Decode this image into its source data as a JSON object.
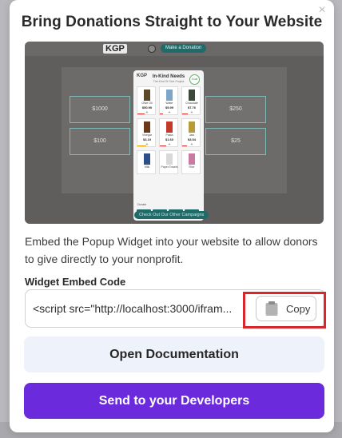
{
  "modal": {
    "title": "Bring Donations Straight to Your Website",
    "close_icon": "close-icon",
    "description": "Embed the Popup Widget into your website to allow donors to give directly to your nonprofit.",
    "embed_label": "Widget Embed Code",
    "embed_code_value": "<script src=\"http://localhost:3000/ifram...",
    "copy_label": "Copy",
    "copy_icon": "clipboard-icon",
    "doc_button_label": "Open Documentation",
    "dev_button_label": "Send to your Developers",
    "accent_color": "#6b2bdd",
    "highlight_color": "#d8262c"
  },
  "preview": {
    "logo": "KGP",
    "nav_pill": "Make a Donation",
    "bottom_pill": "Check Out Our Other Campaigns",
    "donation_amounts": [
      "$1000",
      "$250",
      "$100",
      "$25"
    ],
    "widget": {
      "title": "In-Kind Needs",
      "subtitle": "The Kind Of Give Project",
      "badge": "Goal",
      "donate_label": "Donate",
      "items": [
        {
          "name": "Olive Oil",
          "price": "$50.90"
        },
        {
          "name": "Water",
          "price": "$5.99"
        },
        {
          "name": "Chocolate",
          "price": "$7.76"
        },
        {
          "name": "Vinegar",
          "price": "$3.19"
        },
        {
          "name": "Pasta",
          "price": "$1.60"
        },
        {
          "name": "Jars",
          "price": "$3.54"
        },
        {
          "name": "Milk",
          "price": ""
        },
        {
          "name": "Paper Towels",
          "price": ""
        },
        {
          "name": "Rice",
          "price": ""
        }
      ],
      "amounts": [
        "$25",
        "$50",
        "$100",
        "$250"
      ]
    }
  }
}
